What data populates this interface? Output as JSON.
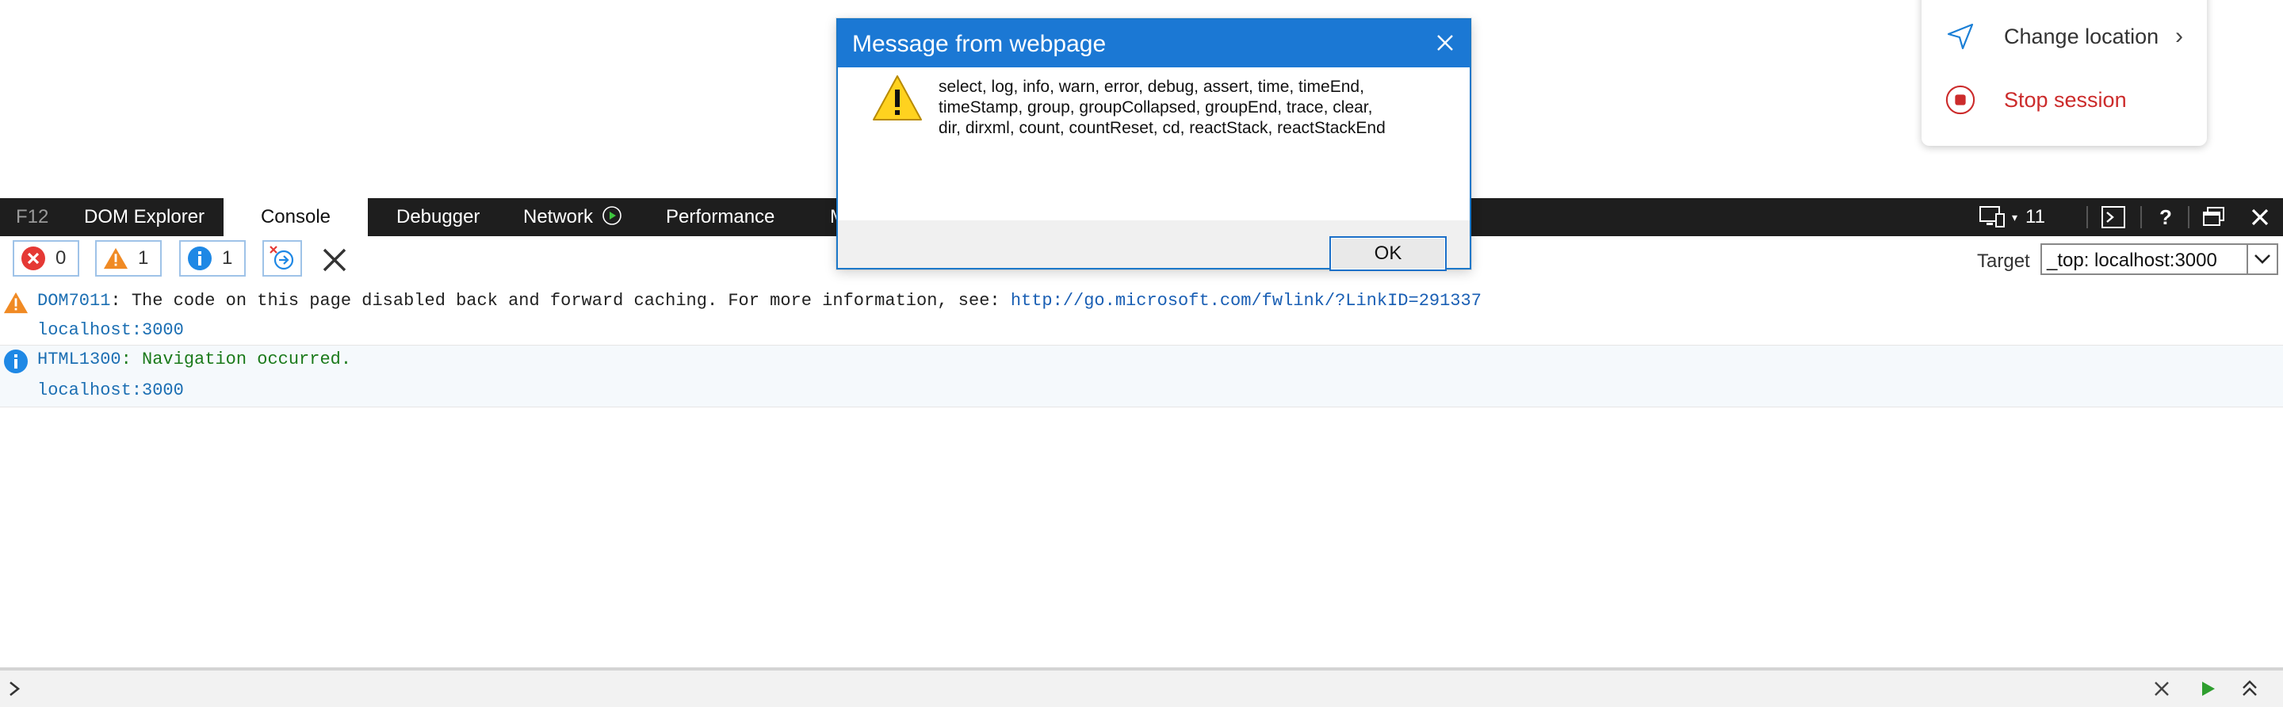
{
  "session_menu": {
    "items": [
      {
        "label": "Change location",
        "icon": "navigation-arrow-icon"
      },
      {
        "label": "Stop session",
        "icon": "stop-icon"
      }
    ],
    "accent": "#1a7fd6",
    "stop_color": "#cc2b2b"
  },
  "toolbar": {
    "tabs": [
      {
        "label": "F12"
      },
      {
        "label": "DOM Explorer"
      },
      {
        "label": "Console"
      },
      {
        "label": "Debugger"
      },
      {
        "label": "Network"
      },
      {
        "label": "Performance"
      },
      {
        "label": "M"
      }
    ],
    "active_tab": "Console",
    "doc_mode": "11"
  },
  "filters": {
    "errors": "0",
    "warnings": "1",
    "info": "1",
    "target_label": "Target",
    "target_value": "_top: localhost:3000"
  },
  "messages": [
    {
      "type": "warning",
      "code": "DOM7011",
      "text": ": The code on this page disabled back and forward caching. For more information, see: ",
      "link": "http://go.microsoft.com/fwlink/?LinkID=291337",
      "source": "localhost:3000"
    },
    {
      "type": "info",
      "code": "HTML1300",
      "text": ": Navigation occurred.",
      "source": "localhost:3000"
    }
  ],
  "dialog": {
    "title": "Message from webpage",
    "lines": [
      "select, log, info, warn, error, debug, assert, time, timeEnd,",
      "timeStamp, group, groupCollapsed, groupEnd, trace, clear,",
      "dir, dirxml, count, countReset, cd, reactStack, reactStackEnd"
    ],
    "ok_label": "OK"
  },
  "colors": {
    "toolbar_bg": "#1e1e1e",
    "dialog_title_bg": "#1b78d4",
    "warning_orange": "#f08a24",
    "info_blue": "#1e88e5",
    "error_red": "#e53935"
  }
}
